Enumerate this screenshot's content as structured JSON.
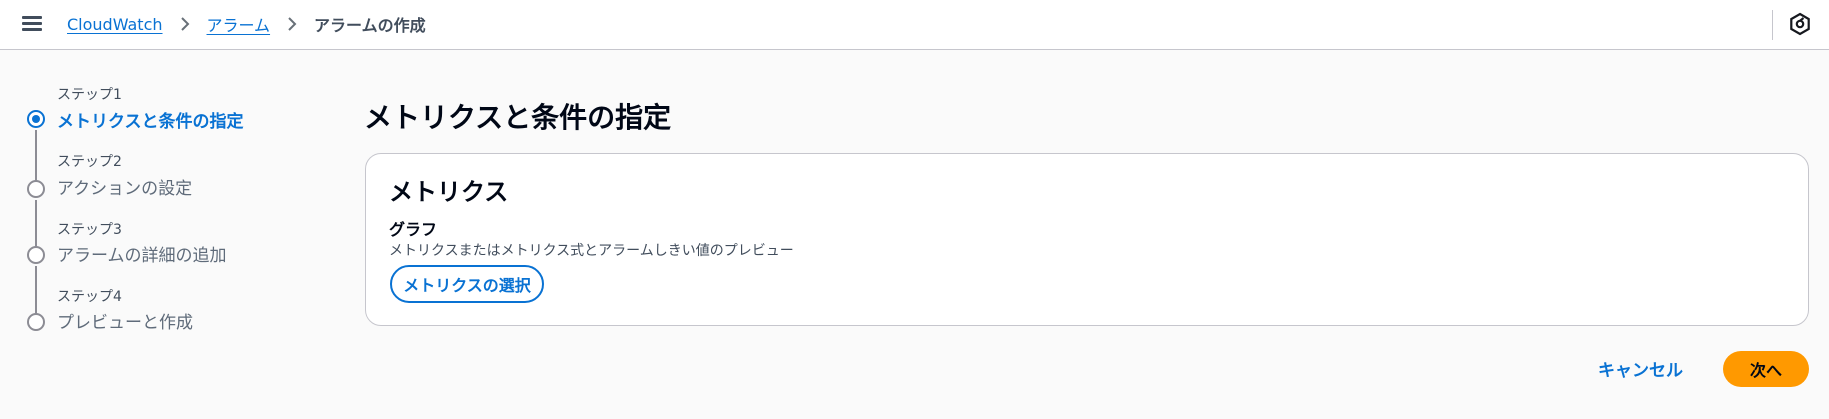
{
  "header": {
    "menu_icon": "hamburger-menu-icon",
    "breadcrumb": {
      "items": [
        {
          "label": "CloudWatch"
        },
        {
          "label": "アラーム"
        },
        {
          "label": "アラームの作成"
        }
      ]
    },
    "right_icon": "settings-hex-icon"
  },
  "steps": [
    {
      "label": "ステップ1",
      "title": "メトリクスと条件の指定",
      "active": true
    },
    {
      "label": "ステップ2",
      "title": "アクションの設定",
      "active": false
    },
    {
      "label": "ステップ3",
      "title": "アラームの詳細の追加",
      "active": false
    },
    {
      "label": "ステップ4",
      "title": "プレビューと作成",
      "active": false
    }
  ],
  "main": {
    "heading": "メトリクスと条件の指定",
    "card": {
      "title": "メトリクス",
      "graph_label": "グラフ",
      "graph_description": "メトリクスまたはメトリクス式とアラームしきい値のプレビュー",
      "select_button": "メトリクスの選択"
    }
  },
  "footer": {
    "cancel_label": "キャンセル",
    "next_label": "次へ"
  },
  "colors": {
    "link": "#0972d3",
    "primary_button": "#ff9900",
    "border": "#c6c6cd",
    "background": "#fafafa"
  }
}
